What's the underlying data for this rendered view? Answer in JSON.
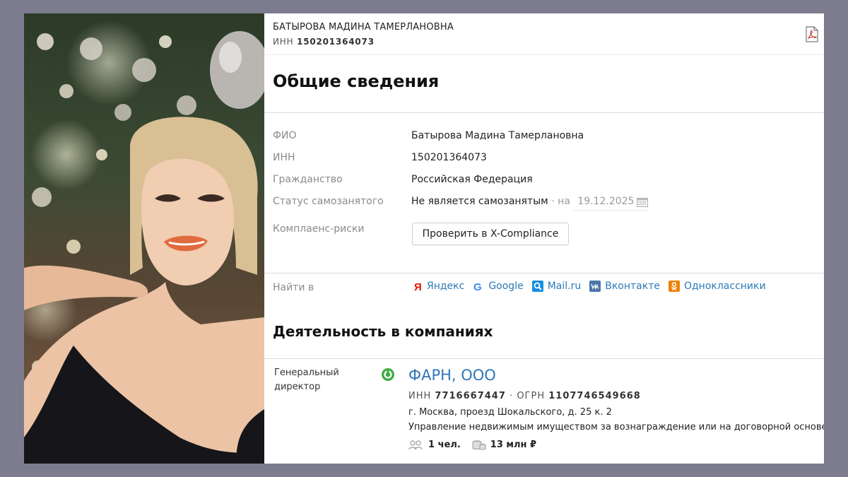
{
  "header": {
    "person_name": "БАТЫРОВА МАДИНА ТАМЕРЛАНОВНА",
    "inn_label": "ИНН",
    "inn_value": "150201364073",
    "pdf_icon": "pdf-export-icon"
  },
  "general": {
    "title": "Общие сведения",
    "rows": [
      {
        "label": "ФИО",
        "value": "Батырова Мадина Тамерлановна"
      },
      {
        "label": "ИНН",
        "value": "150201364073"
      },
      {
        "label": "Гражданство",
        "value": "Российская Федерация"
      },
      {
        "label": "Статус самозанятого",
        "value": "Не является самозанятым",
        "separator": "·",
        "on_label": "на",
        "date": "19.12.2025"
      },
      {
        "label": "Комплаенс-риски",
        "button": "Проверить в X-Compliance"
      }
    ]
  },
  "search": {
    "label": "Найти в",
    "links": [
      {
        "label": "Яндекс",
        "icon": "yandex-icon",
        "color": "#e61400"
      },
      {
        "label": "Google",
        "icon": "google-icon",
        "color": "#4285f4"
      },
      {
        "label": "Mail.ru",
        "icon": "mailru-icon",
        "color": "#168de2"
      },
      {
        "label": "Вконтакте",
        "icon": "vk-icon",
        "color": "#4a76a8"
      },
      {
        "label": "Одноклассники",
        "icon": "ok-icon",
        "color": "#ee8208"
      }
    ]
  },
  "companies": {
    "title": "Деятельность в компаниях",
    "items": [
      {
        "role_line1": "Генеральный",
        "role_line2": "директор",
        "status_icon": "active-status-icon",
        "name": "ФАРН, ООО",
        "inn_label": "ИНН",
        "inn": "7716667447",
        "ogrn_label": "ОГРН",
        "ogrn": "1107746549668",
        "address": "г. Москва, проезд Шокальского, д. 25 к. 2",
        "activity": "Управление недвижимым имуществом за вознаграждение или на договорной основе",
        "employees": "1 чел.",
        "employees_icon": "people-icon",
        "revenue": "13 млн ₽",
        "revenue_icon": "coins-icon"
      }
    ]
  },
  "colors": {
    "background": "#7d7c8e",
    "link": "#2a7ab8",
    "company_link": "#2f76b8",
    "status_green": "#3fae49"
  }
}
